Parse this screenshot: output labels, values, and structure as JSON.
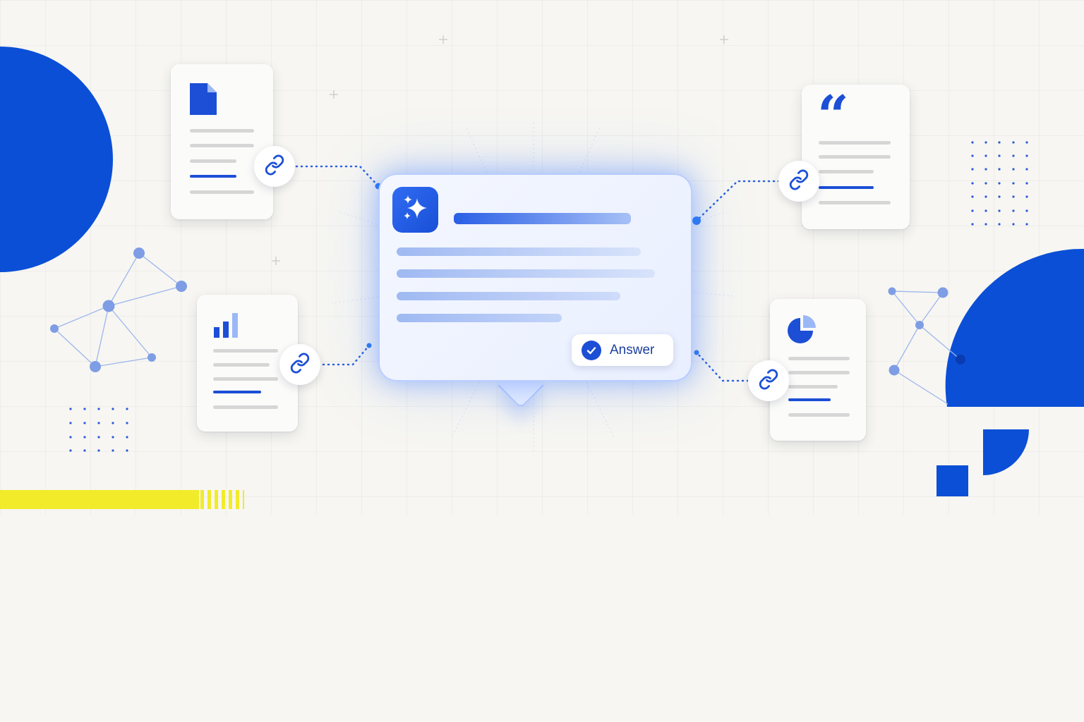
{
  "colors": {
    "brand_blue": "#1c4fd6",
    "light_blue": "#8fb0f5",
    "yellow": "#f2eb2a",
    "background": "#f7f6f2"
  },
  "icons": {
    "sparkle": "sparkle-icon",
    "link": "link-icon",
    "document": "document-icon",
    "bar_chart": "bar-chart-icon",
    "quote": "quote-icon",
    "pie_chart": "pie-chart-icon",
    "check": "check-icon"
  },
  "quote_glyph": "“",
  "answer": {
    "label": "Answer"
  }
}
